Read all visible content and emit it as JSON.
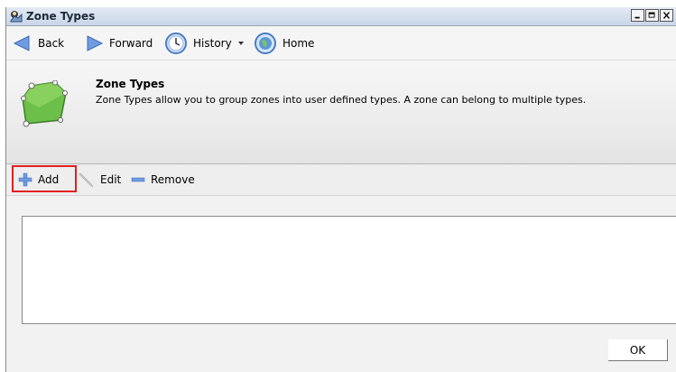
{
  "window": {
    "title": "Zone Types",
    "controls": [
      "minimize",
      "maximize",
      "close"
    ]
  },
  "nav": {
    "back_label": "Back",
    "forward_label": "Forward",
    "history_label": "History",
    "home_label": "Home"
  },
  "header": {
    "title": "Zone Types",
    "description": "Zone Types allow you to group zones into user defined types. A zone can belong to multiple types."
  },
  "toolbar": {
    "add_label": "Add",
    "edit_label": "Edit",
    "remove_label": "Remove"
  },
  "list": {
    "items": []
  },
  "footer": {
    "ok_label": "OK"
  },
  "colors": {
    "highlight": "#e02020",
    "zone_green": "#6cc04a"
  },
  "icons": {
    "title": "zone-types-icon",
    "back": "back-arrow-icon",
    "forward": "forward-arrow-icon",
    "history": "clock-icon",
    "home": "globe-icon",
    "header": "zone-polygon-icon",
    "add": "plus-icon",
    "edit": "pencil-icon",
    "remove": "minus-icon"
  }
}
